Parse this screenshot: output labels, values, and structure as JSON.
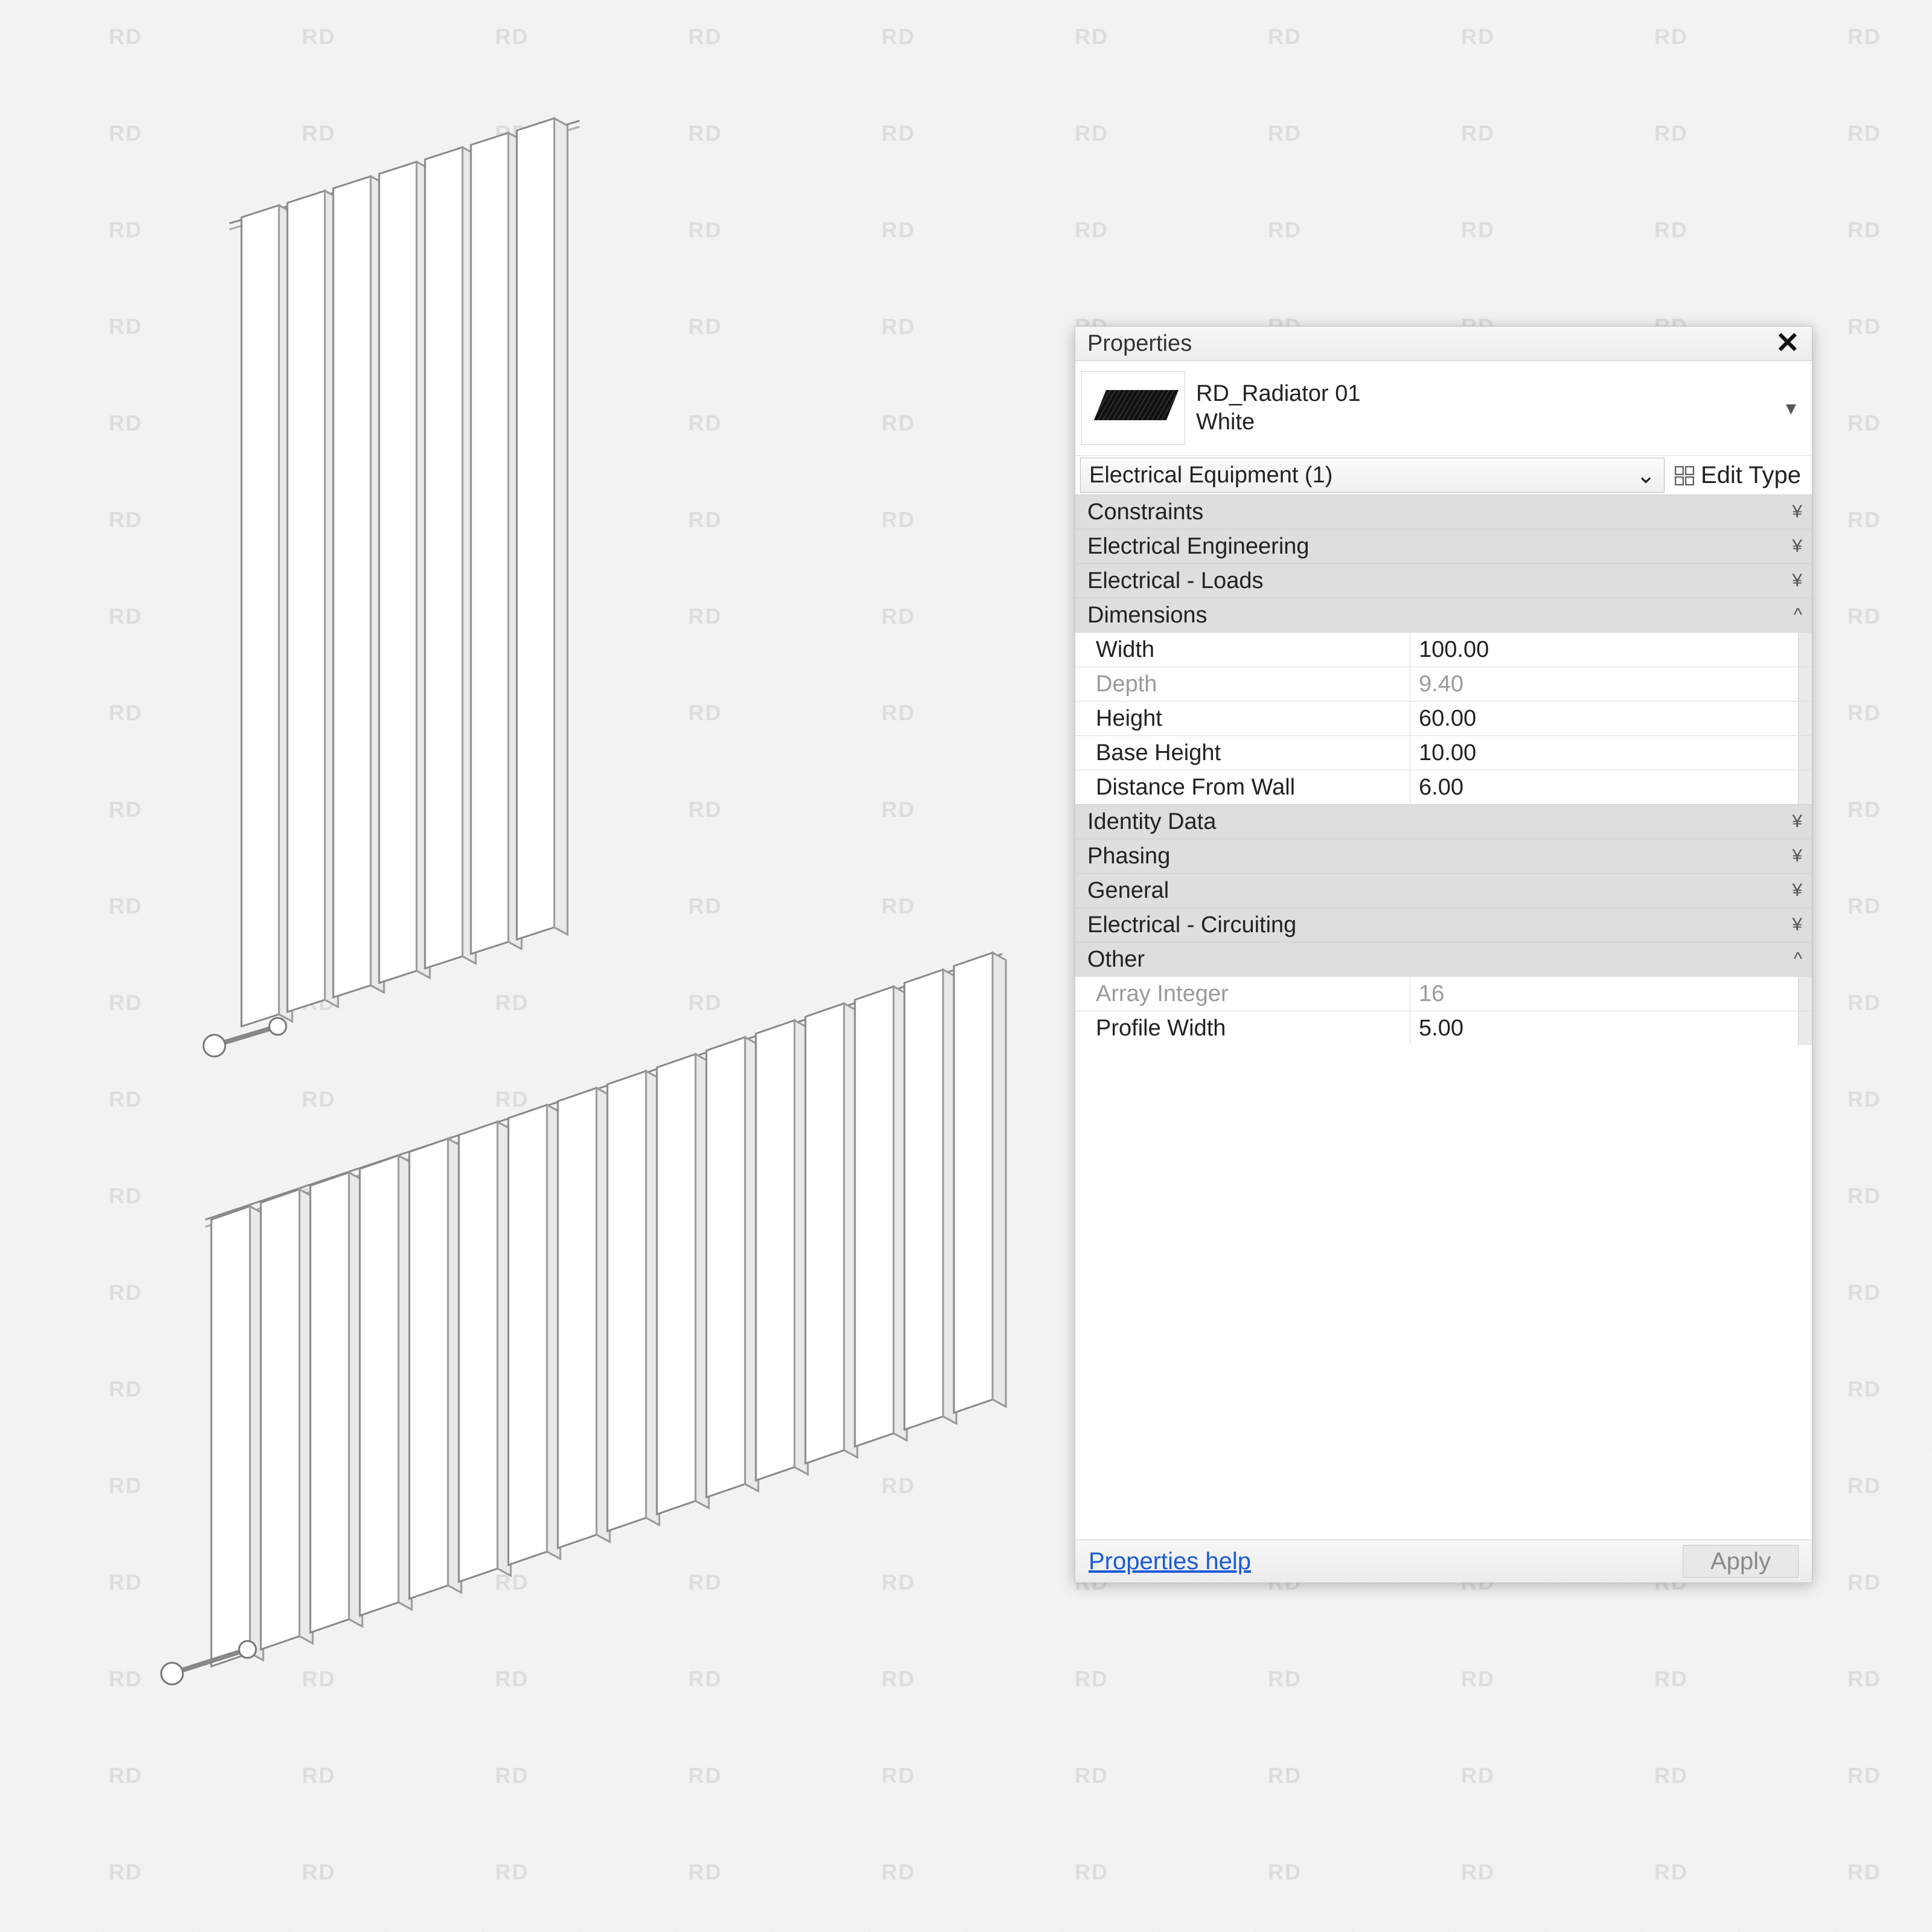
{
  "watermark_text": "RD",
  "panel": {
    "title": "Properties",
    "family_name": "RD_Radiator 01",
    "type_name": "White",
    "category_select": "Electrical Equipment (1)",
    "edit_type_label": "Edit Type",
    "groups": [
      {
        "name": "constraints",
        "label": "Constraints",
        "collapsed": true
      },
      {
        "name": "electrical_engineering",
        "label": "Electrical Engineering",
        "collapsed": true
      },
      {
        "name": "electrical_loads",
        "label": "Electrical - Loads",
        "collapsed": true
      },
      {
        "name": "dimensions",
        "label": "Dimensions",
        "collapsed": false
      },
      {
        "name": "identity_data",
        "label": "Identity Data",
        "collapsed": true
      },
      {
        "name": "phasing",
        "label": "Phasing",
        "collapsed": true
      },
      {
        "name": "general",
        "label": "General",
        "collapsed": true
      },
      {
        "name": "electrical_circuiting",
        "label": "Electrical - Circuiting",
        "collapsed": true
      },
      {
        "name": "other",
        "label": "Other",
        "collapsed": false
      }
    ],
    "dimensions": {
      "width": {
        "label": "Width",
        "value": "100.00",
        "readonly": false
      },
      "depth": {
        "label": "Depth",
        "value": "9.40",
        "readonly": true
      },
      "height": {
        "label": "Height",
        "value": "60.00",
        "readonly": false
      },
      "base_height": {
        "label": "Base Height",
        "value": "10.00",
        "readonly": false
      },
      "distance_from_wall": {
        "label": "Distance From Wall",
        "value": "6.00",
        "readonly": false
      }
    },
    "other": {
      "array_integer": {
        "label": "Array Integer",
        "value": "16",
        "readonly": true
      },
      "profile_width": {
        "label": "Profile Width",
        "value": "5.00",
        "readonly": false
      }
    },
    "help_label": "Properties help",
    "apply_label": "Apply"
  }
}
